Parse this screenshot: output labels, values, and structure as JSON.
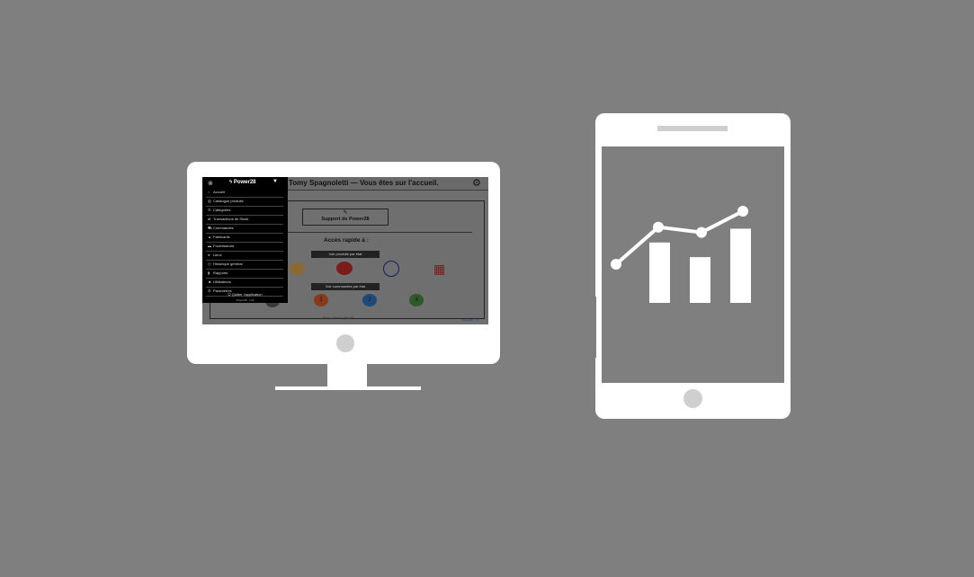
{
  "desktop": {
    "header_title": "Tomy Spagnoletti — Vous êtes sur l'accueil.",
    "gear_icon": "gear-icon",
    "support_button": "Support de Power28",
    "quick_access_label": "Accès rapide à :",
    "products_by_state_button": "Voir produits par état",
    "orders_by_state_button": "Voir commandes par état",
    "orders_numbers": [
      "1",
      "2",
      "3"
    ],
    "footer_left": "Bienv. Version (Nb 28)",
    "footer_right": "Power28 · v.1",
    "sidebar": {
      "brand": "Power28",
      "items": [
        {
          "label": "Accueil",
          "icon": "home-icon"
        },
        {
          "label": "Catalogue produits",
          "icon": "catalog-icon"
        },
        {
          "label": "Catégories",
          "icon": "list-icon"
        },
        {
          "label": "Transactions de Stock",
          "icon": "transactions-icon"
        },
        {
          "label": "Commandes",
          "icon": "cart-icon"
        },
        {
          "label": "Fabricants",
          "icon": "factory-icon"
        },
        {
          "label": "Fournisseurs",
          "icon": "truck-icon"
        },
        {
          "label": "Lieux",
          "icon": "location-icon"
        },
        {
          "label": "Historique général",
          "icon": "history-icon"
        },
        {
          "label": "Rapports",
          "icon": "chart-icon"
        },
        {
          "label": "Utilisateurs",
          "icon": "users-icon"
        },
        {
          "label": "Paramètres",
          "icon": "settings-icon"
        }
      ],
      "quit_label": "Quitter l'application",
      "version": "Power28 · v.10"
    }
  },
  "tablet": {
    "chart_data": {
      "type": "bar",
      "bars_relative": [
        0.7,
        0.53,
        0.86
      ],
      "line_relative": [
        0.5,
        0.85,
        0.8,
        1.0
      ]
    }
  },
  "colors": {
    "background": "#7f7f7f",
    "device": "#ffffff"
  }
}
